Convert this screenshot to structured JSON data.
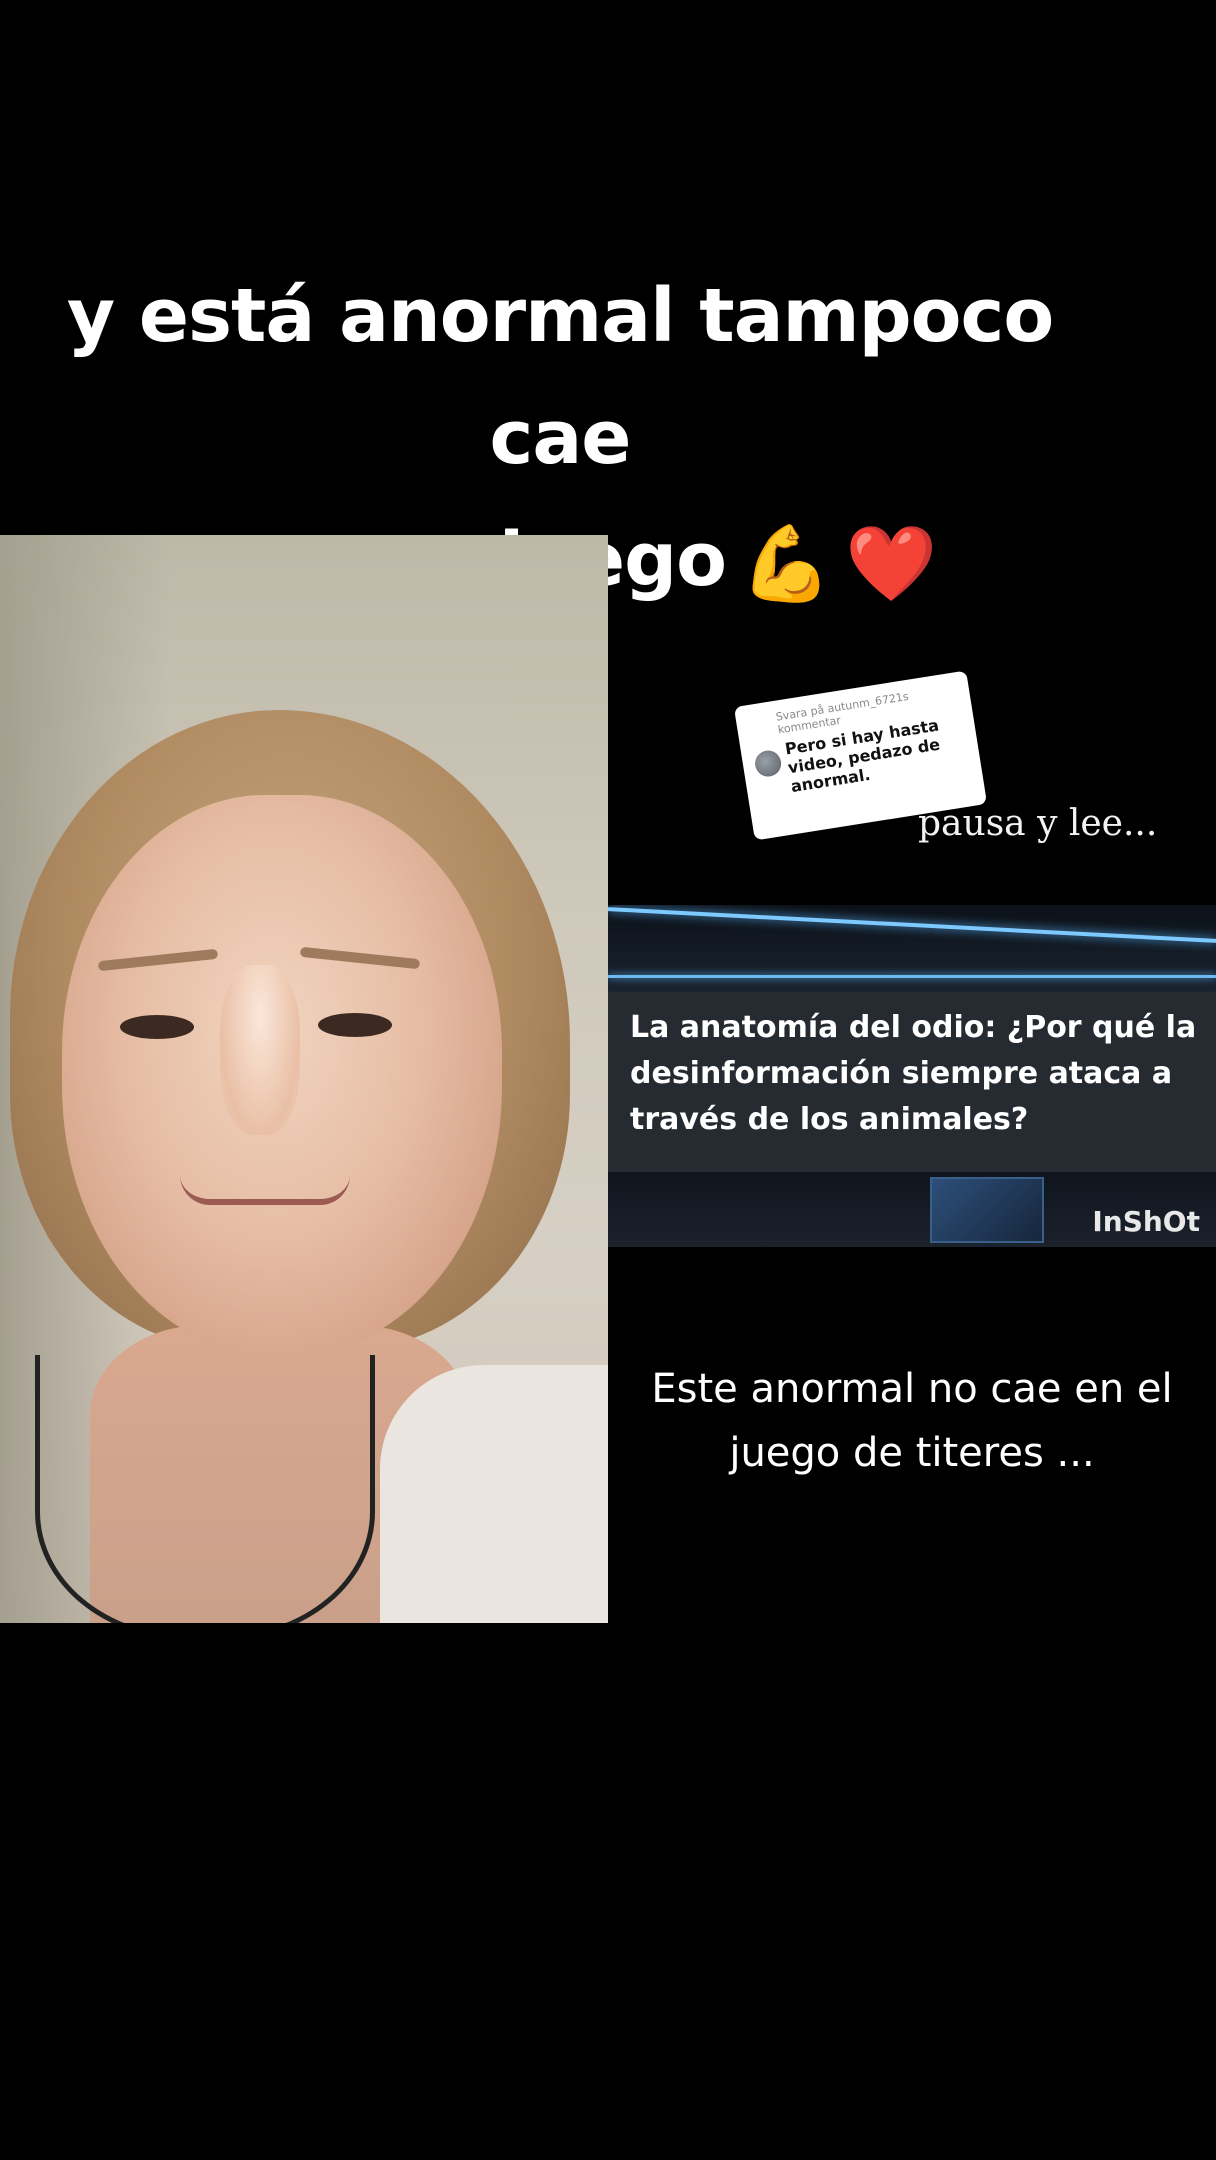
{
  "caption": {
    "line1": "y está anormal tampoco cae",
    "line2": "en su juego",
    "emojis": [
      "💪",
      "❤️"
    ]
  },
  "selfie_panel": {
    "description_icon": "selfie-photo"
  },
  "comment_card": {
    "reply_to": "Svara på autunm_6721s kommentar",
    "text": "Pero si hay hasta video, pedazo de anormal."
  },
  "pausa_text": "pausa y lee...",
  "news": {
    "headline": "La anatomía del odio: ¿Por qué la desinformación siempre ataca a través de los animales?",
    "watermark": "InShOt"
  },
  "bottom_text": "Este anormal no cae en el juego de titeres ..."
}
